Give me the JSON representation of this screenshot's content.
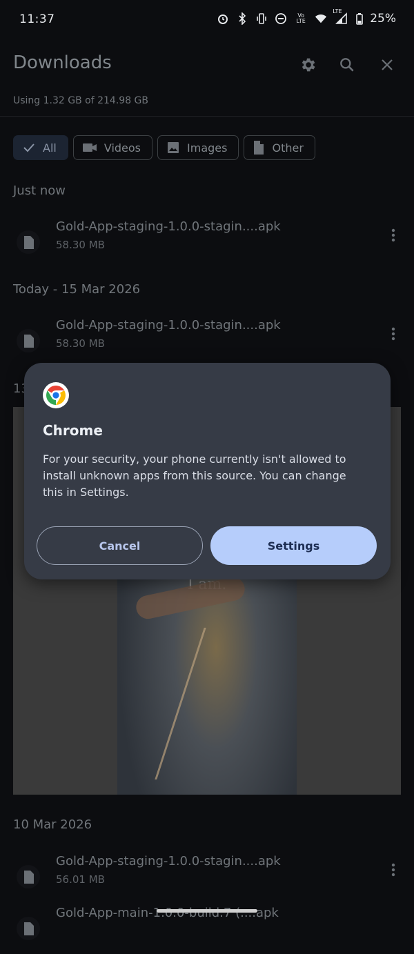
{
  "status": {
    "time": "11:37",
    "battery": "25%",
    "icons": [
      "alarm-icon",
      "bluetooth-icon",
      "vibrate-icon",
      "dnd-icon",
      "volte-icon",
      "wifi-icon",
      "lte-signal-icon",
      "battery-icon"
    ],
    "volte_label": "Vo LTE",
    "lte_label": "LTE"
  },
  "appbar": {
    "title": "Downloads",
    "usage": "Using 1.32 GB of 214.98 GB",
    "actions": [
      "settings-icon",
      "search-icon",
      "close-icon"
    ]
  },
  "filters": {
    "chips": [
      {
        "label": "All",
        "icon": "check-icon",
        "selected": true
      },
      {
        "label": "Videos",
        "icon": "video-icon",
        "selected": false
      },
      {
        "label": "Images",
        "icon": "image-icon",
        "selected": false
      },
      {
        "label": "Other",
        "icon": "file-icon",
        "selected": false
      }
    ]
  },
  "sections": [
    {
      "heading": "Just now",
      "items": [
        {
          "name": "Gold-App-staging-1.0.0-stagin....apk",
          "size": "58.30 MB"
        }
      ]
    },
    {
      "heading": "Today - 15 Mar 2026",
      "items": [
        {
          "name": "Gold-App-staging-1.0.0-stagin....apk",
          "size": "58.30 MB"
        }
      ]
    },
    {
      "heading": "13",
      "items": []
    },
    {
      "heading": "10 Mar 2026",
      "items": [
        {
          "name": "Gold-App-staging-1.0.0-stagin....apk",
          "size": "56.01 MB"
        },
        {
          "name": "Gold-App-main-1.0.0-build.7 (....apk",
          "size": ""
        }
      ]
    }
  ],
  "image_preview": {
    "caption": "I am."
  },
  "dialog": {
    "app_name": "Chrome",
    "message": "For your security, your phone currently isn't allowed to install unknown apps from this source. You can change this in Settings.",
    "cancel_label": "Cancel",
    "settings_label": "Settings"
  },
  "colors": {
    "background": "#0c0d10",
    "dialog": "#363b46",
    "primary_button": "#b6cdfb",
    "accent_text": "#b8c6ec"
  }
}
